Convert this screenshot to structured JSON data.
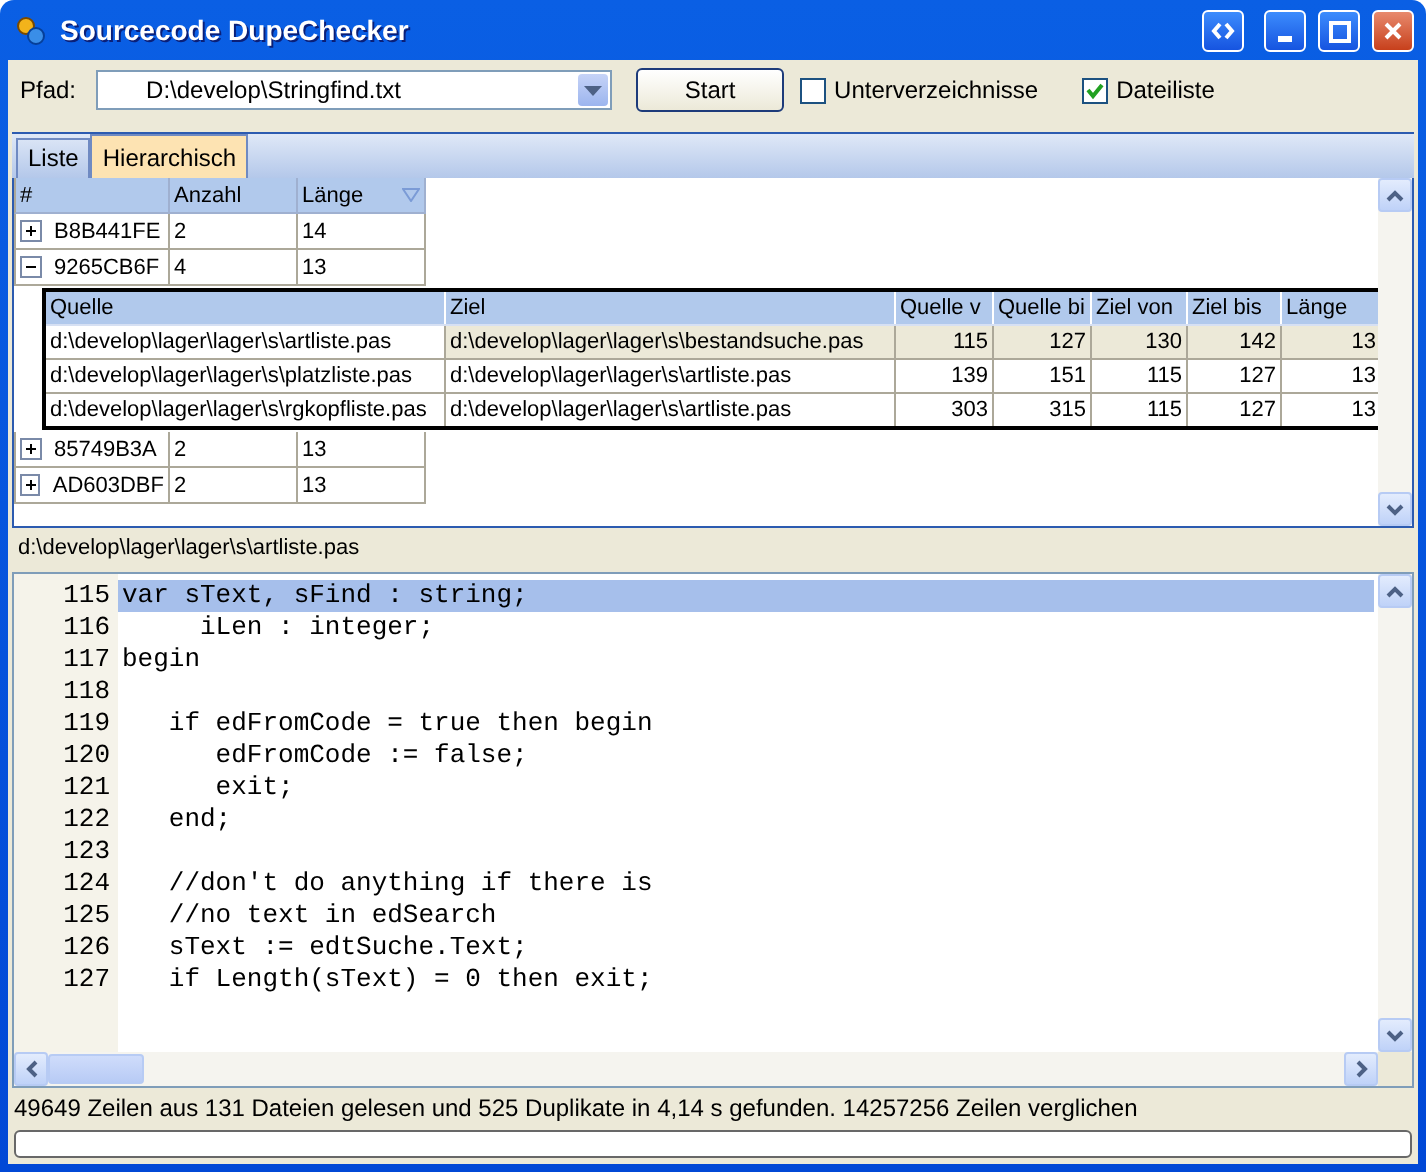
{
  "window": {
    "title": "Sourcecode DupeChecker"
  },
  "toolbar": {
    "path_label": "Pfad:",
    "path_value": "D:\\develop\\Stringfind.txt",
    "start_button": "Start",
    "checkboxes": [
      {
        "label": "Unterverzeichnisse",
        "checked": false
      },
      {
        "label": "Dateiliste",
        "checked": true
      }
    ]
  },
  "tabs": [
    {
      "label": "Liste",
      "selected": false
    },
    {
      "label": "Hierarchisch",
      "selected": true
    }
  ],
  "master_table": {
    "columns": [
      {
        "label": "#",
        "sorted": false
      },
      {
        "label": "Anzahl",
        "sorted": false
      },
      {
        "label": "Länge",
        "sorted": true
      }
    ],
    "rows": [
      {
        "cells": [
          "B8B441FE",
          "2",
          "14"
        ],
        "expanded": false
      },
      {
        "cells": [
          "9265CB6F",
          "4",
          "13"
        ],
        "expanded": true,
        "details": {
          "columns": [
            "Quelle",
            "Ziel",
            "Quelle v",
            "Quelle bi",
            "Ziel von",
            "Ziel bis",
            "Länge"
          ],
          "rows": [
            {
              "cells": [
                "d:\\develop\\lager\\lager\\s\\artliste.pas",
                "d:\\develop\\lager\\lager\\s\\bestandsuche.pas",
                "115",
                "127",
                "130",
                "142",
                "13"
              ],
              "selected": true
            },
            {
              "cells": [
                "d:\\develop\\lager\\lager\\s\\platzliste.pas",
                "d:\\develop\\lager\\lager\\s\\artliste.pas",
                "139",
                "151",
                "115",
                "127",
                "13"
              ],
              "selected": false
            },
            {
              "cells": [
                "d:\\develop\\lager\\lager\\s\\rgkopfliste.pas",
                "d:\\develop\\lager\\lager\\s\\artliste.pas",
                "303",
                "315",
                "115",
                "127",
                "13"
              ],
              "selected": false
            }
          ]
        }
      },
      {
        "cells": [
          "85749B3A",
          "2",
          "13"
        ],
        "expanded": false
      },
      {
        "cells": [
          "AD603DBF",
          "2",
          "13"
        ],
        "expanded": false
      }
    ]
  },
  "code_view": {
    "file_path": "d:\\develop\\lager\\lager\\s\\artliste.pas",
    "lines": [
      {
        "number": "115",
        "text": "var sText, sFind : string;",
        "selected": true
      },
      {
        "number": "116",
        "text": "     iLen : integer;",
        "selected": false
      },
      {
        "number": "117",
        "text": "begin",
        "selected": false
      },
      {
        "number": "118",
        "selected": false
      },
      {
        "number": "119",
        "text": "   if edFromCode = true then begin",
        "selected": false
      },
      {
        "number": "120",
        "text": "      edFromCode := false;",
        "selected": false
      },
      {
        "number": "121",
        "text": "      exit;",
        "selected": false
      },
      {
        "number": "122",
        "text": "   end;",
        "selected": false
      },
      {
        "number": "123",
        "selected": false
      },
      {
        "number": "124",
        "text": "   //don't do anything if there is",
        "selected": false
      },
      {
        "number": "125",
        "text": "   //no text in edSearch",
        "selected": false
      },
      {
        "number": "126",
        "text": "   sText := edtSuche.Text;",
        "selected": false
      },
      {
        "number": "127",
        "text": "   if Length(sText) = 0 then exit;",
        "selected": false
      }
    ]
  },
  "status_bar": {
    "text": "49649 Zeilen aus 131 Dateien gelesen und 525 Duplikate in 4,14 s gefunden. 14257256 Zeilen verglichen",
    "progress": {
      "level": 0
    }
  }
}
